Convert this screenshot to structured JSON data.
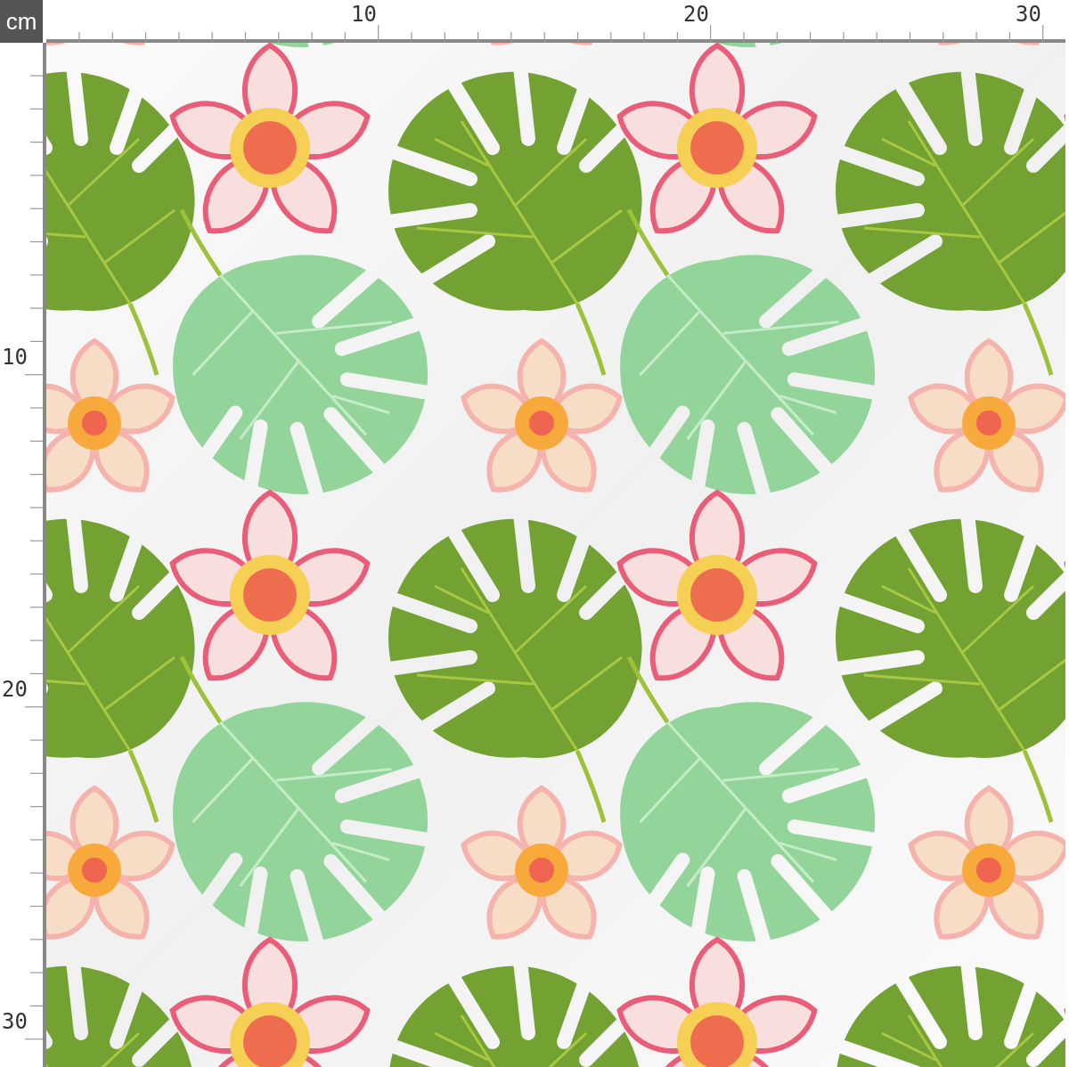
{
  "unit": "cm",
  "top_ruler": {
    "labels": [
      "10",
      "20",
      "30"
    ]
  },
  "left_ruler": {
    "labels": [
      "10",
      "20",
      "30"
    ]
  }
}
